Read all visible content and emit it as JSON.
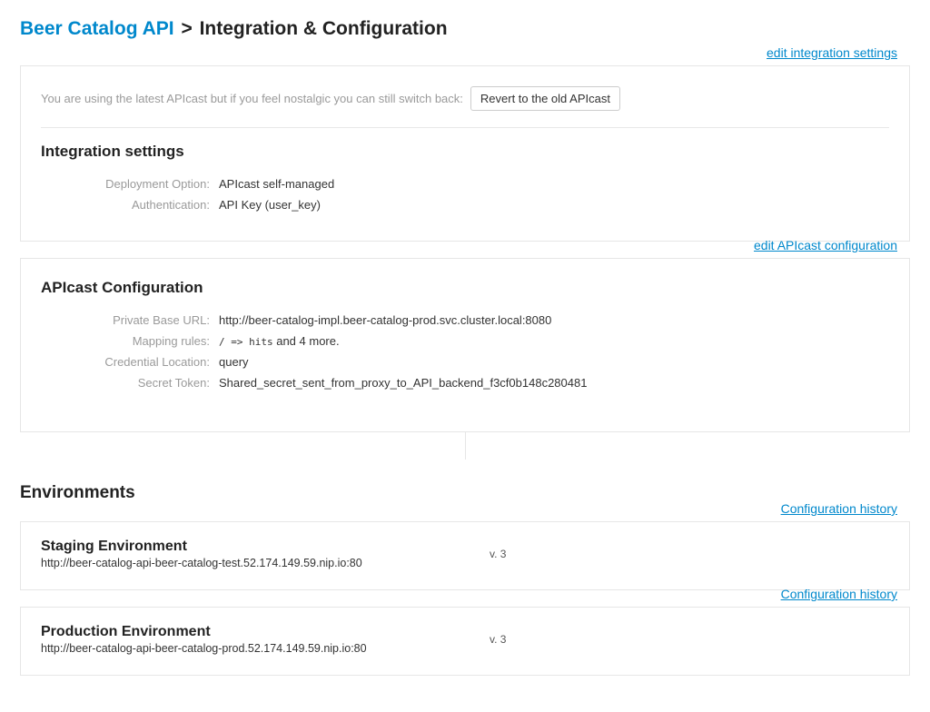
{
  "breadcrumb": {
    "api_name": "Beer Catalog API",
    "separator": ">",
    "current": "Integration & Configuration"
  },
  "integration_settings": {
    "edit_link": "edit integration settings",
    "notice_text": "You are using the latest APIcast but if you feel nostalgic you can still switch back:",
    "revert_button": "Revert to the old APIcast",
    "title": "Integration settings",
    "rows": {
      "deployment_label": "Deployment Option:",
      "deployment_value": "APIcast self-managed",
      "auth_label": "Authentication:",
      "auth_value": "API Key (user_key)"
    }
  },
  "apicast_config": {
    "edit_link": "edit APIcast configuration",
    "title": "APIcast Configuration",
    "rows": {
      "base_url_label": "Private Base URL:",
      "base_url_value": "http://beer-catalog-impl.beer-catalog-prod.svc.cluster.local:8080",
      "mapping_label": "Mapping rules:",
      "mapping_code": "/ => hits",
      "mapping_suffix": " and 4 more.",
      "credential_label": "Credential Location:",
      "credential_value": "query",
      "secret_label": "Secret Token:",
      "secret_value": "Shared_secret_sent_from_proxy_to_API_backend_f3cf0b148c280481"
    }
  },
  "environments": {
    "heading": "Environments",
    "config_history": "Configuration history",
    "staging": {
      "title": "Staging Environment",
      "url": "http://beer-catalog-api-beer-catalog-test.52.174.149.59.nip.io:80",
      "version": "v. 3"
    },
    "production": {
      "title": "Production Environment",
      "url": "http://beer-catalog-api-beer-catalog-prod.52.174.149.59.nip.io:80",
      "version": "v. 3"
    }
  }
}
